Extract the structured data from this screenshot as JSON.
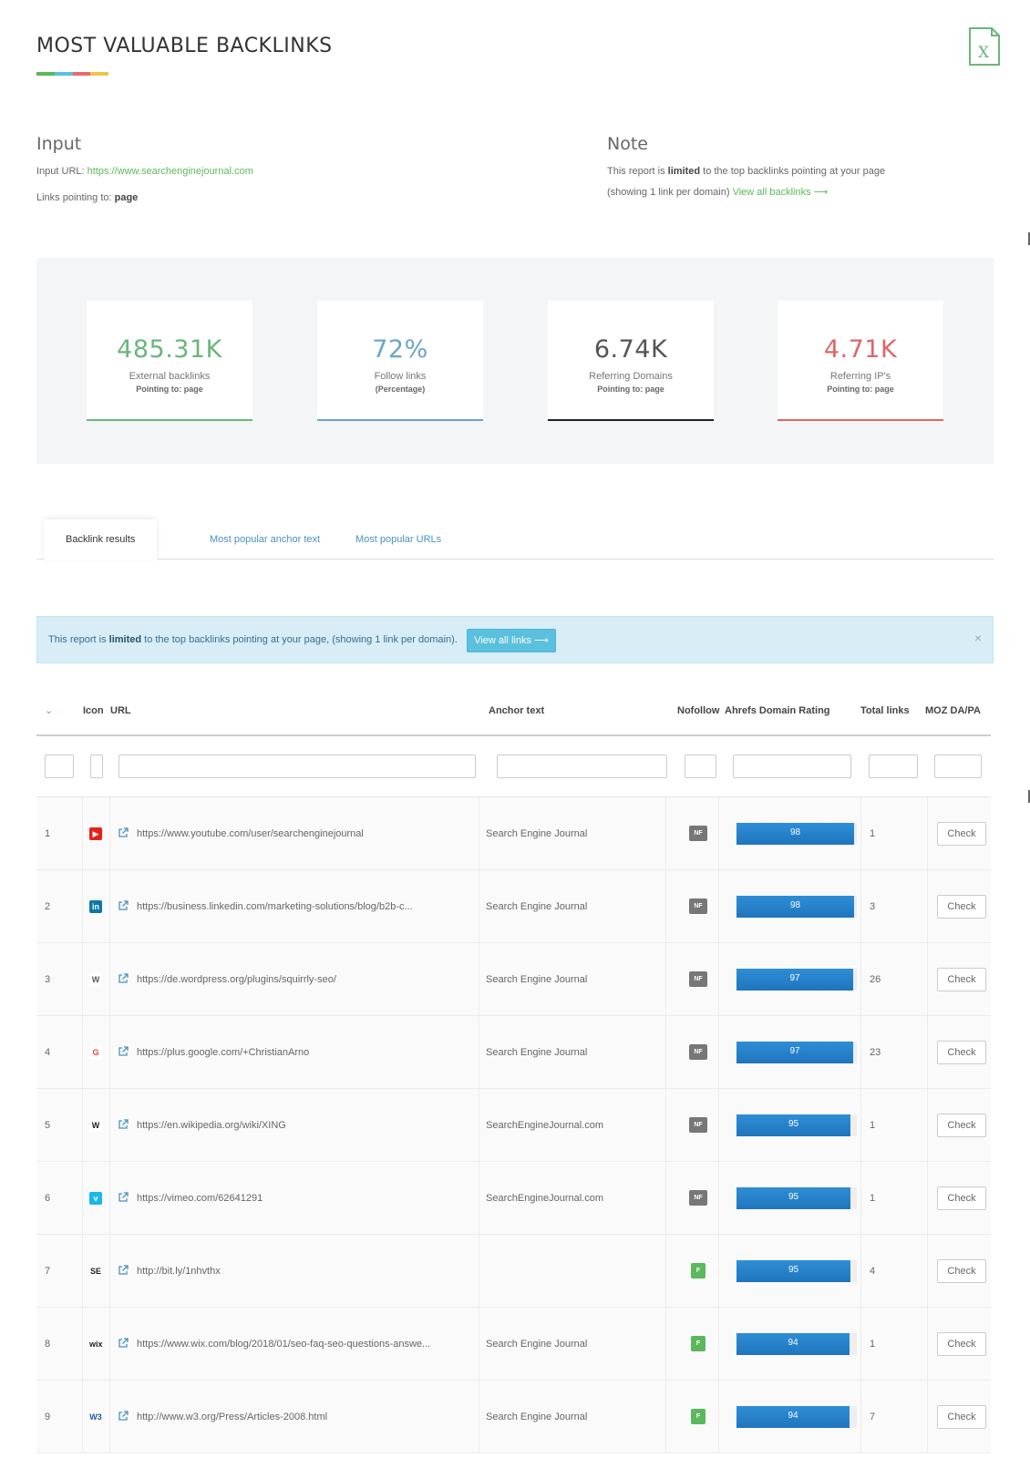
{
  "page": {
    "title": "MOST VALUABLE BACKLINKS",
    "title_bar_colors": [
      "#5cb85c",
      "#5bc0de",
      "#e66b6b",
      "#f0c24b"
    ],
    "export_icon": "excel-icon"
  },
  "input": {
    "heading": "Input",
    "url_label": "Input URL:",
    "url_value": "https://www.searchenginejournal.com",
    "links_label": "Links pointing to:",
    "links_value": "page"
  },
  "note": {
    "heading": "Note",
    "line1_a": "This report is ",
    "line1_b": "limited",
    "line1_c": " to the top backlinks pointing at your page",
    "line2_a": "(showing 1 link per domain) ",
    "line2_link": "View all backlinks ⟶"
  },
  "stats": [
    {
      "value": "485.31K",
      "label": "External backlinks",
      "sub": "Pointing to: page",
      "color": "#6bb67a"
    },
    {
      "value": "72%",
      "label": "Follow links",
      "sub": "(Percentage)",
      "color": "#6aa5c8"
    },
    {
      "value": "6.74K",
      "label": "Referring Domains",
      "sub": "Pointing to: page",
      "color": "#555555"
    },
    {
      "value": "4.71K",
      "label": "Referring IP's",
      "sub": "Pointing to: page",
      "color": "#e06666"
    }
  ],
  "tabs": [
    "Backlink results",
    "Most popular anchor text",
    "Most popular URLs"
  ],
  "alert": {
    "text_a": "This report is ",
    "text_b": "limited",
    "text_c": " to the top backlinks pointing at your page, (showing 1 link per domain).",
    "button": "View all links ⟶",
    "close": "×"
  },
  "table": {
    "headers": {
      "icon": "Icon",
      "url": "URL",
      "anchor": "Anchor text",
      "nofollow": "Nofollow",
      "dr": "Ahrefs Domain Rating",
      "total": "Total links",
      "moz": "MOZ DA/PA"
    },
    "check_label": "Check",
    "rows": [
      {
        "num": "1",
        "icon": "youtube-icon",
        "favicon_text": "▶",
        "favicon_bg": "#e62117",
        "favicon_color": "#ffffff",
        "url": "https://www.youtube.com/user/searchenginejournal",
        "anchor": "Search Engine Journal",
        "nf": "NF",
        "dr": 98,
        "total": "1"
      },
      {
        "num": "2",
        "icon": "linkedin-icon",
        "favicon_text": "in",
        "favicon_bg": "#0e76a8",
        "favicon_color": "#ffffff",
        "url": "https://business.linkedin.com/marketing-solutions/blog/b2b-c...",
        "anchor": "Search Engine Journal",
        "nf": "NF",
        "dr": 98,
        "total": "3"
      },
      {
        "num": "3",
        "icon": "wordpress-icon",
        "favicon_text": "W",
        "favicon_bg": "#ffffff",
        "favicon_color": "#555555",
        "url": "https://de.wordpress.org/plugins/squirrly-seo/",
        "anchor": "Search Engine Journal",
        "nf": "NF",
        "dr": 97,
        "total": "26"
      },
      {
        "num": "4",
        "icon": "google-icon",
        "favicon_text": "G",
        "favicon_bg": "#ffffff",
        "favicon_color": "#e2463b",
        "url": "https://plus.google.com/+ChristianArno",
        "anchor": "Search Engine Journal",
        "nf": "NF",
        "dr": 97,
        "total": "23"
      },
      {
        "num": "5",
        "icon": "wikipedia-icon",
        "favicon_text": "W",
        "favicon_bg": "#ffffff",
        "favicon_color": "#222222",
        "url": "https://en.wikipedia.org/wiki/XING",
        "anchor": "SearchEngineJournal.com",
        "nf": "NF",
        "dr": 95,
        "total": "1"
      },
      {
        "num": "6",
        "icon": "vimeo-icon",
        "favicon_text": "v",
        "favicon_bg": "#1ab7ea",
        "favicon_color": "#ffffff",
        "url": "https://vimeo.com/62641291",
        "anchor": "SearchEngineJournal.com",
        "nf": "NF",
        "dr": 95,
        "total": "1"
      },
      {
        "num": "7",
        "icon": "sej-icon",
        "favicon_text": "SE",
        "favicon_bg": "#ffffff",
        "favicon_color": "#222222",
        "url": "http://bit.ly/1nhvthx",
        "anchor": "",
        "nf": "F",
        "dr": 95,
        "total": "4"
      },
      {
        "num": "8",
        "icon": "wix-icon",
        "favicon_text": "wix",
        "favicon_bg": "#ffffff",
        "favicon_color": "#222222",
        "url": "https://www.wix.com/blog/2018/01/seo-faq-seo-questions-answe...",
        "anchor": "Search Engine Journal",
        "nf": "F",
        "dr": 94,
        "total": "1"
      },
      {
        "num": "9",
        "icon": "w3c-icon",
        "favicon_text": "W3",
        "favicon_bg": "#ffffff",
        "favicon_color": "#1a5aa6",
        "url": "http://www.w3.org/Press/Articles-2008.html",
        "anchor": "Search Engine Journal",
        "nf": "F",
        "dr": 94,
        "total": "7"
      }
    ]
  },
  "colors": {
    "nf_badge": "#777777",
    "f_badge": "#5cb85c",
    "dr_bar": "#1f7fcb"
  }
}
